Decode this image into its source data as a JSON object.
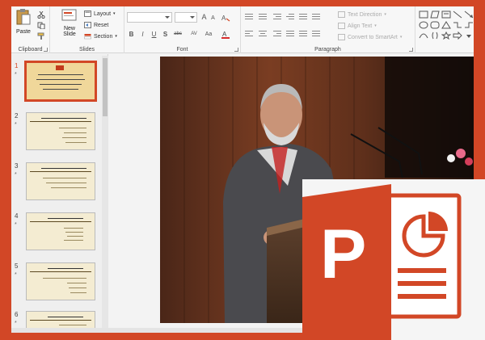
{
  "ribbon": {
    "clipboard": {
      "paste": "Paste",
      "label": "Clipboard"
    },
    "slides": {
      "new_slide_1": "New",
      "new_slide_2": "Slide",
      "layout": "Layout",
      "reset": "Reset",
      "section": "Section",
      "label": "Slides"
    },
    "font": {
      "label": "Font",
      "bold": "B",
      "italic": "I",
      "underline": "U",
      "strike": "S",
      "shadow": "abc",
      "spacing": "AV",
      "case": "Aa",
      "grow": "A",
      "shrink": "A"
    },
    "paragraph": {
      "label": "Paragraph",
      "text_direction": "Text Direction",
      "align_text": "Align Text",
      "convert_smartart": "Convert to SmartArt"
    }
  },
  "slides": [
    {
      "number": "1",
      "star": "*",
      "selected": true
    },
    {
      "number": "2",
      "star": "*",
      "selected": false
    },
    {
      "number": "3",
      "star": "*",
      "selected": false
    },
    {
      "number": "4",
      "star": "*",
      "selected": false
    },
    {
      "number": "5",
      "star": "*",
      "selected": false
    },
    {
      "number": "6",
      "star": "*",
      "selected": false
    }
  ],
  "colors": {
    "frame": "#d24726",
    "logo_dark": "#b7472a",
    "logo_light": "#e64a19"
  },
  "logo": {
    "letter": "P"
  }
}
